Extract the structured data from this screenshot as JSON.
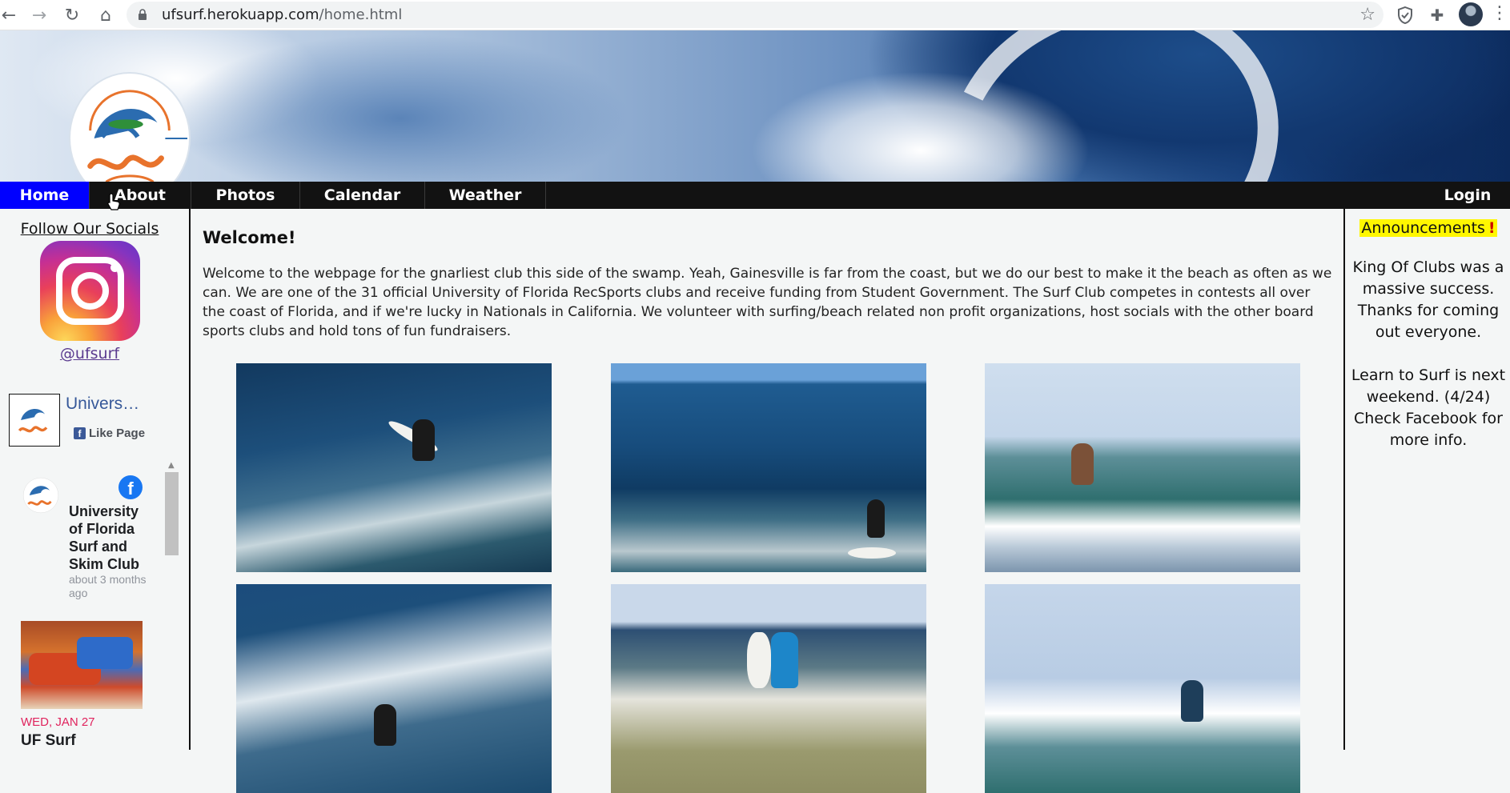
{
  "browser": {
    "url_host": "ufsurf.herokuapp.com",
    "url_path": "/home.html"
  },
  "nav": {
    "items": [
      "Home",
      "About",
      "Photos",
      "Calendar",
      "Weather"
    ],
    "login": "Login",
    "active": "Home"
  },
  "left": {
    "follow": "Follow Our Socials",
    "handle": "@ufsurf",
    "fb_page_name": "University of Florida Surf and Skim Club",
    "fb_page_name_short": "Univers…",
    "fb_like": "Like Page",
    "post": {
      "name": "University of Florida Surf and Skim Club",
      "time": "about 3 months ago"
    },
    "event": {
      "date": "WED, JAN 27",
      "title": "UF Surf"
    }
  },
  "main": {
    "title": "Welcome!",
    "text": "Welcome to the webpage for the gnarliest club this side of the swamp. Yeah, Gainesville is far from the coast, but we do our best to make it the beach as often as we can. We are one of the 31 official University of Florida RecSports clubs and receive funding from Student Government. The Surf Club competes in contests all over the coast of Florida, and if we're lucky in Nationals in California. We volunteer with surfing/beach related non profit organizations, host socials with the other board sports clubs and hold tons of fun fundraisers."
  },
  "right": {
    "title": "Announcements",
    "announcements": [
      "King Of Clubs was a massive success. Thanks for coming out everyone.",
      "Learn to Surf is next weekend. (4/24) Check Facebook for more info."
    ]
  },
  "colors": {
    "nav_active": "#0000ff",
    "nav_bg": "#121212",
    "highlight": "#fff700",
    "fb_blue": "#365899"
  }
}
